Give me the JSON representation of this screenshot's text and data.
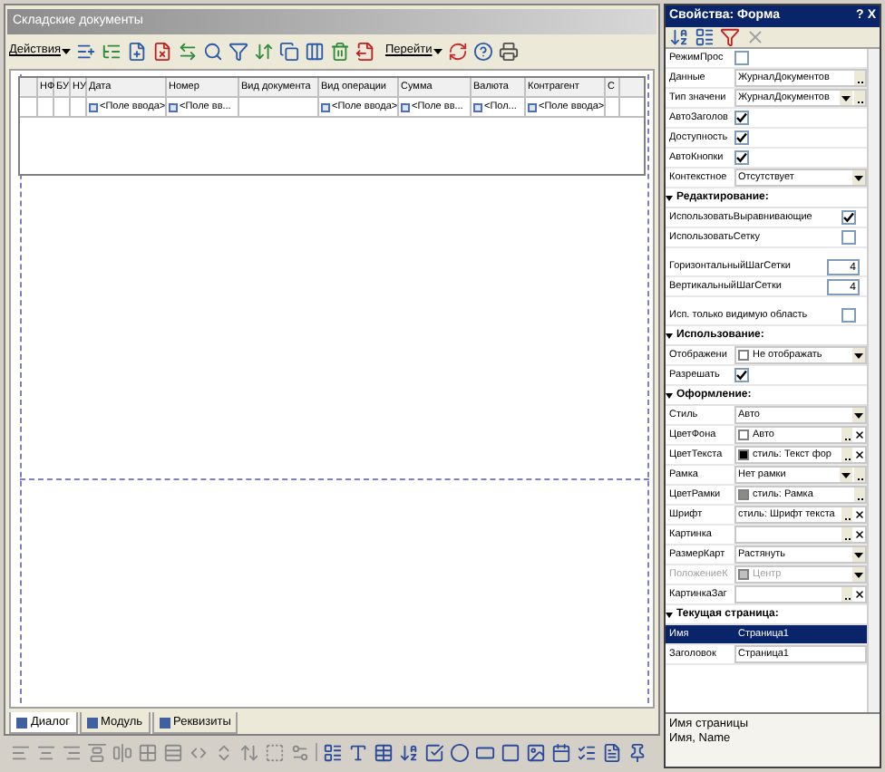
{
  "form": {
    "title": "Складские документы",
    "toolbar": {
      "actions_menu": "Действия",
      "goto_menu": "Перейти"
    },
    "table": {
      "columns": [
        "НФ",
        "БУ",
        "НУ",
        "Дата",
        "Номер",
        "Вид документа",
        "Вид операции",
        "Сумма",
        "Валюта",
        "Контрагент",
        "С"
      ],
      "row": [
        {
          "kind": "empty"
        },
        {
          "kind": "empty"
        },
        {
          "kind": "empty"
        },
        {
          "kind": "field",
          "text": "<Поле ввода>"
        },
        {
          "kind": "field",
          "text": "<Поле вв..."
        },
        {
          "kind": "empty"
        },
        {
          "kind": "field",
          "text": "<Поле ввода>"
        },
        {
          "kind": "field",
          "text": "<Поле вв..."
        },
        {
          "kind": "field",
          "text": "<Пол..."
        },
        {
          "kind": "field",
          "text": "<Поле ввода>"
        },
        {
          "kind": "empty"
        }
      ]
    },
    "tabs": [
      {
        "label": "Диалог",
        "selected": true
      },
      {
        "label": "Модуль",
        "selected": false
      },
      {
        "label": "Реквизиты",
        "selected": false
      }
    ]
  },
  "properties": {
    "title": "Свойства: Форма",
    "close": "X",
    "pin": "?",
    "items": [
      {
        "kind": "check",
        "label": "РежимПрос",
        "checked": false
      },
      {
        "kind": "value",
        "label": "Данные",
        "value": "ЖурналДокументов",
        "ellipsis": true
      },
      {
        "kind": "value",
        "label": "Тип значени",
        "value": "ЖурналДокументов",
        "dropdown": true,
        "ellipsis": true
      },
      {
        "kind": "check",
        "label": "АвтоЗаголов",
        "checked": true
      },
      {
        "kind": "check",
        "label": "Доступность",
        "checked": true
      },
      {
        "kind": "check",
        "label": "АвтоКнопки",
        "checked": true
      },
      {
        "kind": "value",
        "label": "Контекстное",
        "value": "Отсутствует",
        "dropdown": true
      },
      {
        "kind": "section",
        "label": "Редактирование:"
      },
      {
        "kind": "widecheck",
        "label": "ИспользоватьВыравнивающие",
        "checked": true
      },
      {
        "kind": "widecheck",
        "label": "ИспользоватьСетку",
        "checked": false
      },
      {
        "kind": "spacer"
      },
      {
        "kind": "number",
        "label": "ГоризонтальныйШагСетки",
        "value": "4"
      },
      {
        "kind": "number",
        "label": "ВертикальныйШагСетки",
        "value": "4"
      },
      {
        "kind": "spacer"
      },
      {
        "kind": "widecheck",
        "label": "Исп. только видимую область",
        "checked": false
      },
      {
        "kind": "section",
        "label": "Использование:"
      },
      {
        "kind": "value",
        "label": "Отображени",
        "value": "Не отображать",
        "dropdown": true,
        "swatch": true
      },
      {
        "kind": "check",
        "label": "Разрешать",
        "checked": true
      },
      {
        "kind": "section",
        "label": "Оформление:"
      },
      {
        "kind": "value",
        "label": "Стиль",
        "value": "Авто",
        "dropdown": true
      },
      {
        "kind": "value",
        "label": "ЦветФона",
        "value": "Авто",
        "swatch": true,
        "ellipsis": true,
        "clear": true
      },
      {
        "kind": "value",
        "label": "ЦветТекста",
        "value": "стиль: Текст фор",
        "color": "#000000",
        "ellipsis": true,
        "clear": true
      },
      {
        "kind": "value",
        "label": "Рамка",
        "value": "Нет рамки",
        "dropdown": true,
        "ellipsis": true
      },
      {
        "kind": "value",
        "label": "ЦветРамки",
        "value": "стиль: Рамка",
        "color": "#8c8c84",
        "ellipsis": true
      },
      {
        "kind": "value",
        "label": "Шрифт",
        "value": "стиль: Шрифт текста",
        "ellipsis": true,
        "clear": true
      },
      {
        "kind": "value",
        "label": "Картинка",
        "ellipsis": true,
        "clear": true
      },
      {
        "kind": "value",
        "label": "РазмерКарт",
        "value": "Растянуть",
        "dropdown": true
      },
      {
        "kind": "value",
        "label": "ПоложениеК",
        "value": "Центр",
        "dropdown": true,
        "color": "#c0c0c0",
        "disabled": true
      },
      {
        "kind": "value",
        "label": "КартинкаЗаг",
        "ellipsis": true,
        "clear": true
      },
      {
        "kind": "section",
        "label": "Текущая страница:"
      },
      {
        "kind": "value",
        "label": "Имя",
        "value": "Страница1",
        "selected": true
      },
      {
        "kind": "value",
        "label": "Заголовок",
        "value": "Страница1",
        "selected": false
      }
    ],
    "description": [
      "Имя страницы",
      "Имя, Name"
    ]
  }
}
